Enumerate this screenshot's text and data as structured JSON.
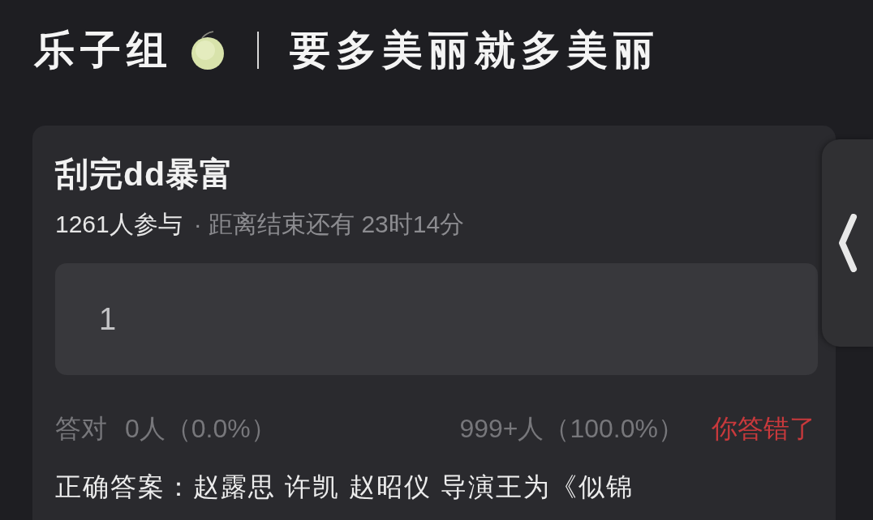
{
  "header": {
    "group_name": "乐子组",
    "slogan": "要多美丽就多美丽"
  },
  "quiz": {
    "title": "刮完dd暴富",
    "participants": "1261人参与",
    "time_left": "· 距离结束还有 23时14分",
    "answer": "1",
    "stats": {
      "correct_label": "答对",
      "correct_count": "0人（0.0%）",
      "wrong_count": "999+人（100.0%）",
      "result": "你答错了"
    },
    "correct_answer": "正确答案：赵露思 许凯 赵昭仪 导演王为《似锦"
  }
}
